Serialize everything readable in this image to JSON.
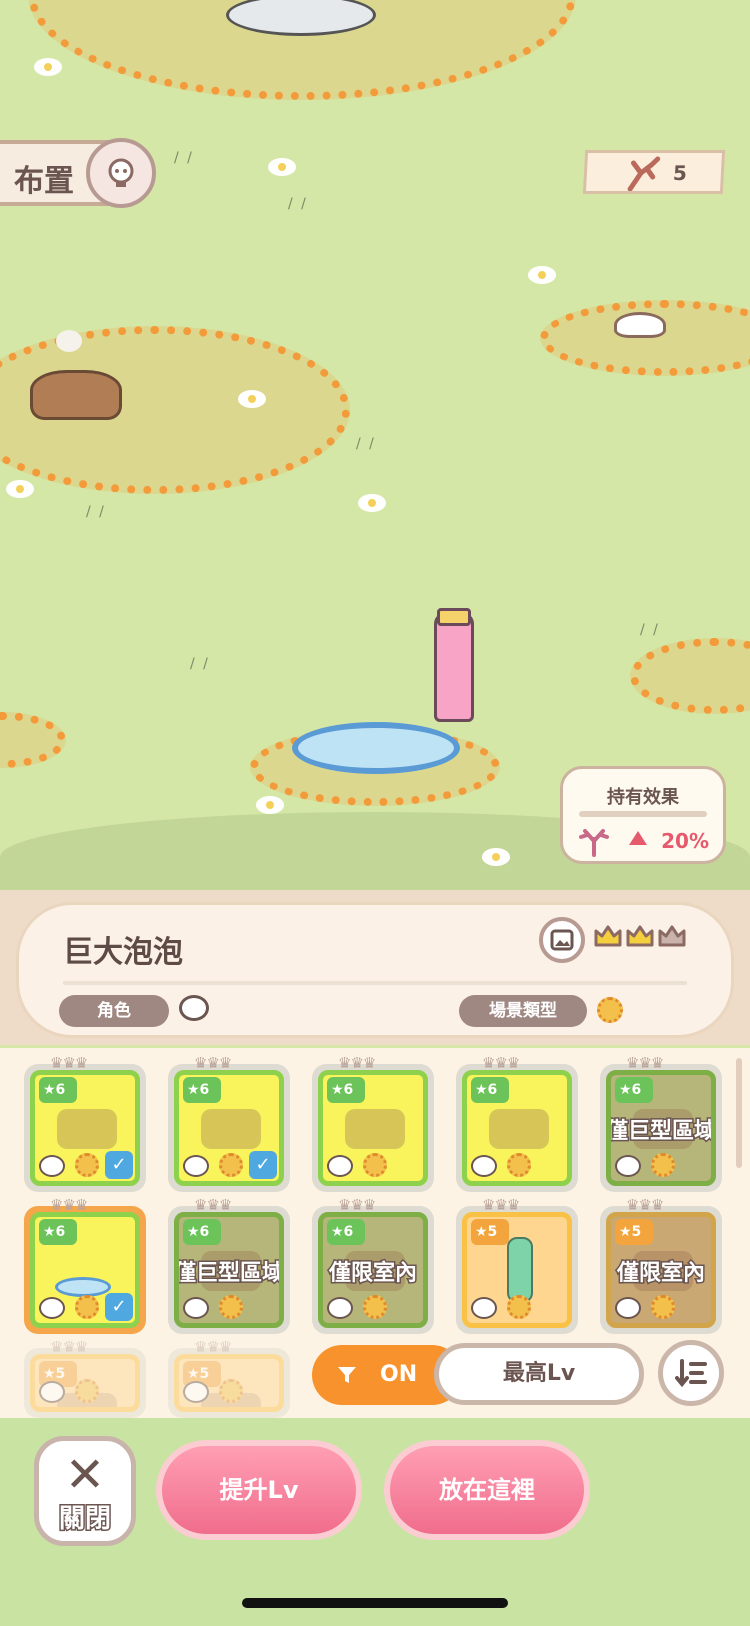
{
  "top": {
    "layout_label": "布置",
    "resource_count": "5"
  },
  "effect": {
    "title": "持有效果",
    "value": "20%"
  },
  "item": {
    "name": "巨大泡泡",
    "role_label": "角色",
    "scene_type_label": "場景類型",
    "crowns_filled": 2,
    "crowns_total": 3
  },
  "cards": [
    {
      "level": "6",
      "rarity": "green",
      "dim": false,
      "selected": false,
      "checked": true,
      "overlay": "",
      "icon": "guitar-stump"
    },
    {
      "level": "6",
      "rarity": "green",
      "dim": false,
      "selected": false,
      "checked": true,
      "overlay": "",
      "icon": "picnic-mat"
    },
    {
      "level": "6",
      "rarity": "green",
      "dim": false,
      "selected": false,
      "checked": false,
      "overlay": "",
      "icon": "stump-oranges"
    },
    {
      "level": "6",
      "rarity": "green",
      "dim": false,
      "selected": false,
      "checked": false,
      "overlay": "",
      "icon": "leaves"
    },
    {
      "level": "6",
      "rarity": "green",
      "dim": true,
      "selected": false,
      "checked": false,
      "overlay": "僅巨型區域",
      "icon": "swing-tree"
    },
    {
      "level": "6",
      "rarity": "green",
      "dim": false,
      "selected": true,
      "checked": true,
      "overlay": "",
      "icon": "bubble-pool"
    },
    {
      "level": "6",
      "rarity": "green",
      "dim": true,
      "selected": false,
      "checked": false,
      "overlay": "僅巨型區域",
      "icon": "rack"
    },
    {
      "level": "6",
      "rarity": "green",
      "dim": true,
      "selected": false,
      "checked": false,
      "overlay": "僅限室內",
      "icon": "box"
    },
    {
      "level": "5",
      "rarity": "orange",
      "dim": false,
      "selected": false,
      "checked": false,
      "overlay": "",
      "icon": "ramune-bottle"
    },
    {
      "level": "5",
      "rarity": "orange",
      "dim": true,
      "selected": false,
      "checked": false,
      "overlay": "僅限室內",
      "icon": "hammock"
    },
    {
      "level": "5",
      "rarity": "orange",
      "dim": false,
      "selected": false,
      "checked": false,
      "overlay": "",
      "icon": "partial"
    },
    {
      "level": "5",
      "rarity": "orange",
      "dim": false,
      "selected": false,
      "checked": false,
      "overlay": "",
      "icon": "partial"
    }
  ],
  "controls": {
    "filter_label": "ON",
    "sort_label": "最高Lv"
  },
  "actions": {
    "close_label": "關閉",
    "level_up_label": "提升Lv",
    "place_label": "放在這裡"
  },
  "colors": {
    "accent_orange": "#f7922c",
    "accent_pink": "#f06d8c",
    "grass": "#d5e7a6",
    "text_brown": "#6b5550"
  }
}
